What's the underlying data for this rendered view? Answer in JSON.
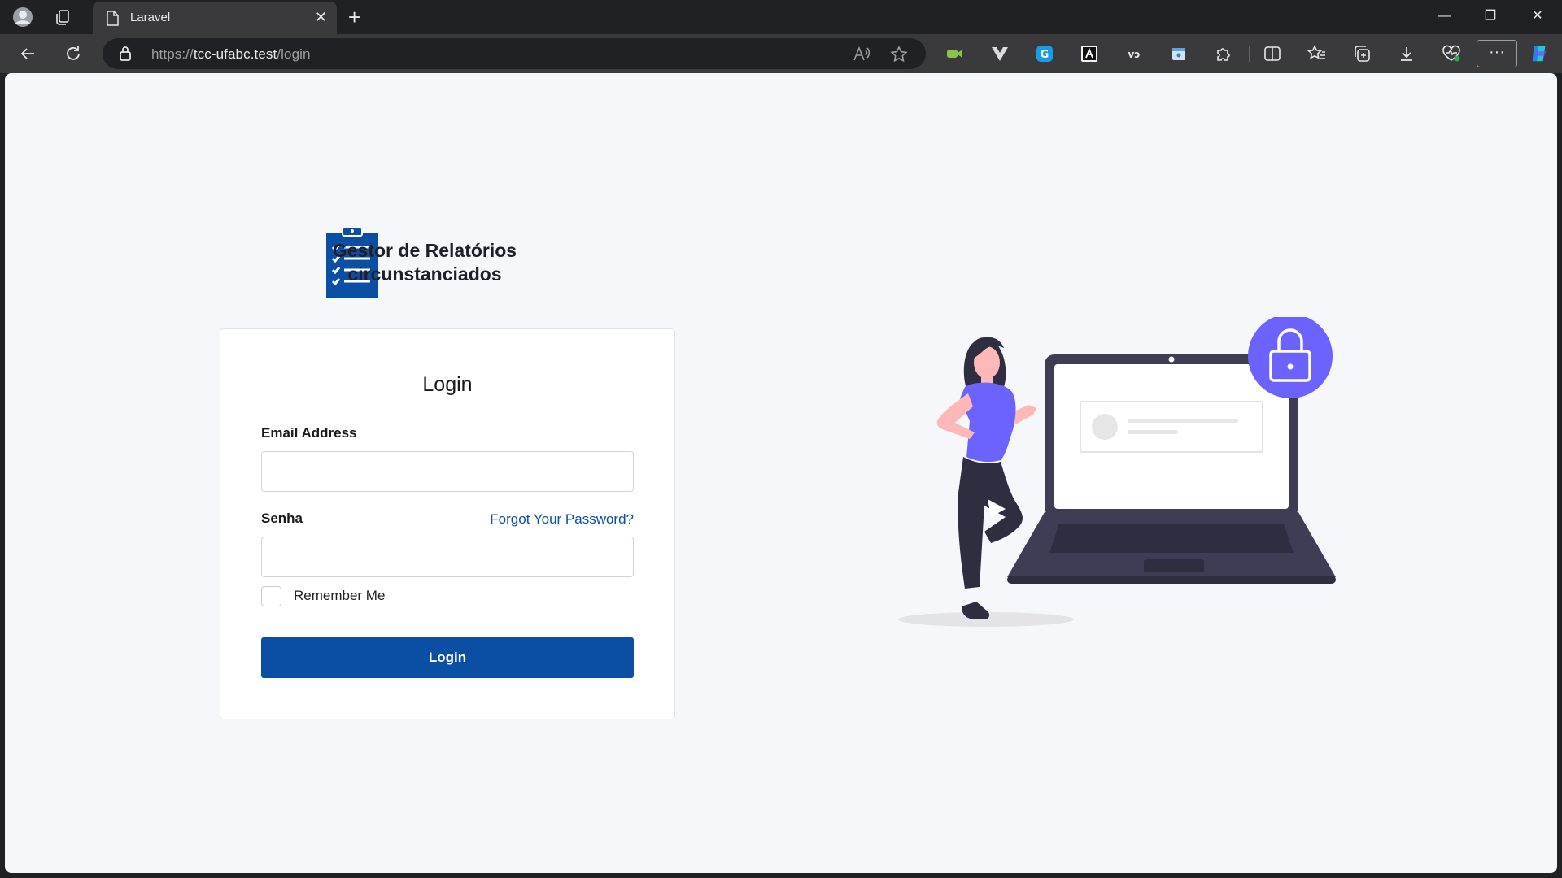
{
  "browser": {
    "tab_title": "Laravel",
    "url_scheme": "https://",
    "url_host": "tcc-ufabc.test",
    "url_path": "/login",
    "icons": {
      "profile": "profile-avatar-icon",
      "workspaces": "workspaces-icon",
      "favicon": "page-icon",
      "close": "close-icon",
      "new_tab": "plus-icon",
      "back": "back-arrow-icon",
      "refresh": "refresh-icon",
      "lock": "lock-icon",
      "read_aloud": "read-aloud-icon",
      "favorite": "star-icon",
      "extensions": "puzzle-icon",
      "split": "split-screen-icon",
      "favorites": "favorites-icon",
      "collections": "collections-icon",
      "downloads": "download-icon",
      "health": "browser-essentials-icon",
      "more": "more-icon",
      "copilot": "copilot-icon"
    },
    "more_label": "···",
    "close_glyph": "✕",
    "new_tab_glyph": "+",
    "minimize_glyph": "—",
    "restore_glyph": "❐",
    "window_close_glyph": "✕"
  },
  "brand": {
    "line1": "Gestor de Relatórios",
    "line2": "circunstanciados",
    "color": "#0a4fa3"
  },
  "login_form": {
    "title": "Login",
    "email_label": "Email Address",
    "email_value": "",
    "password_label": "Senha",
    "password_value": "",
    "forgot_link": "Forgot Your Password?",
    "remember_label": "Remember Me",
    "remember_checked": false,
    "submit_label": "Login"
  },
  "colors": {
    "accent": "#0a4fa3",
    "illustration_accent": "#6c63ff",
    "laptop": "#3f3d56"
  }
}
